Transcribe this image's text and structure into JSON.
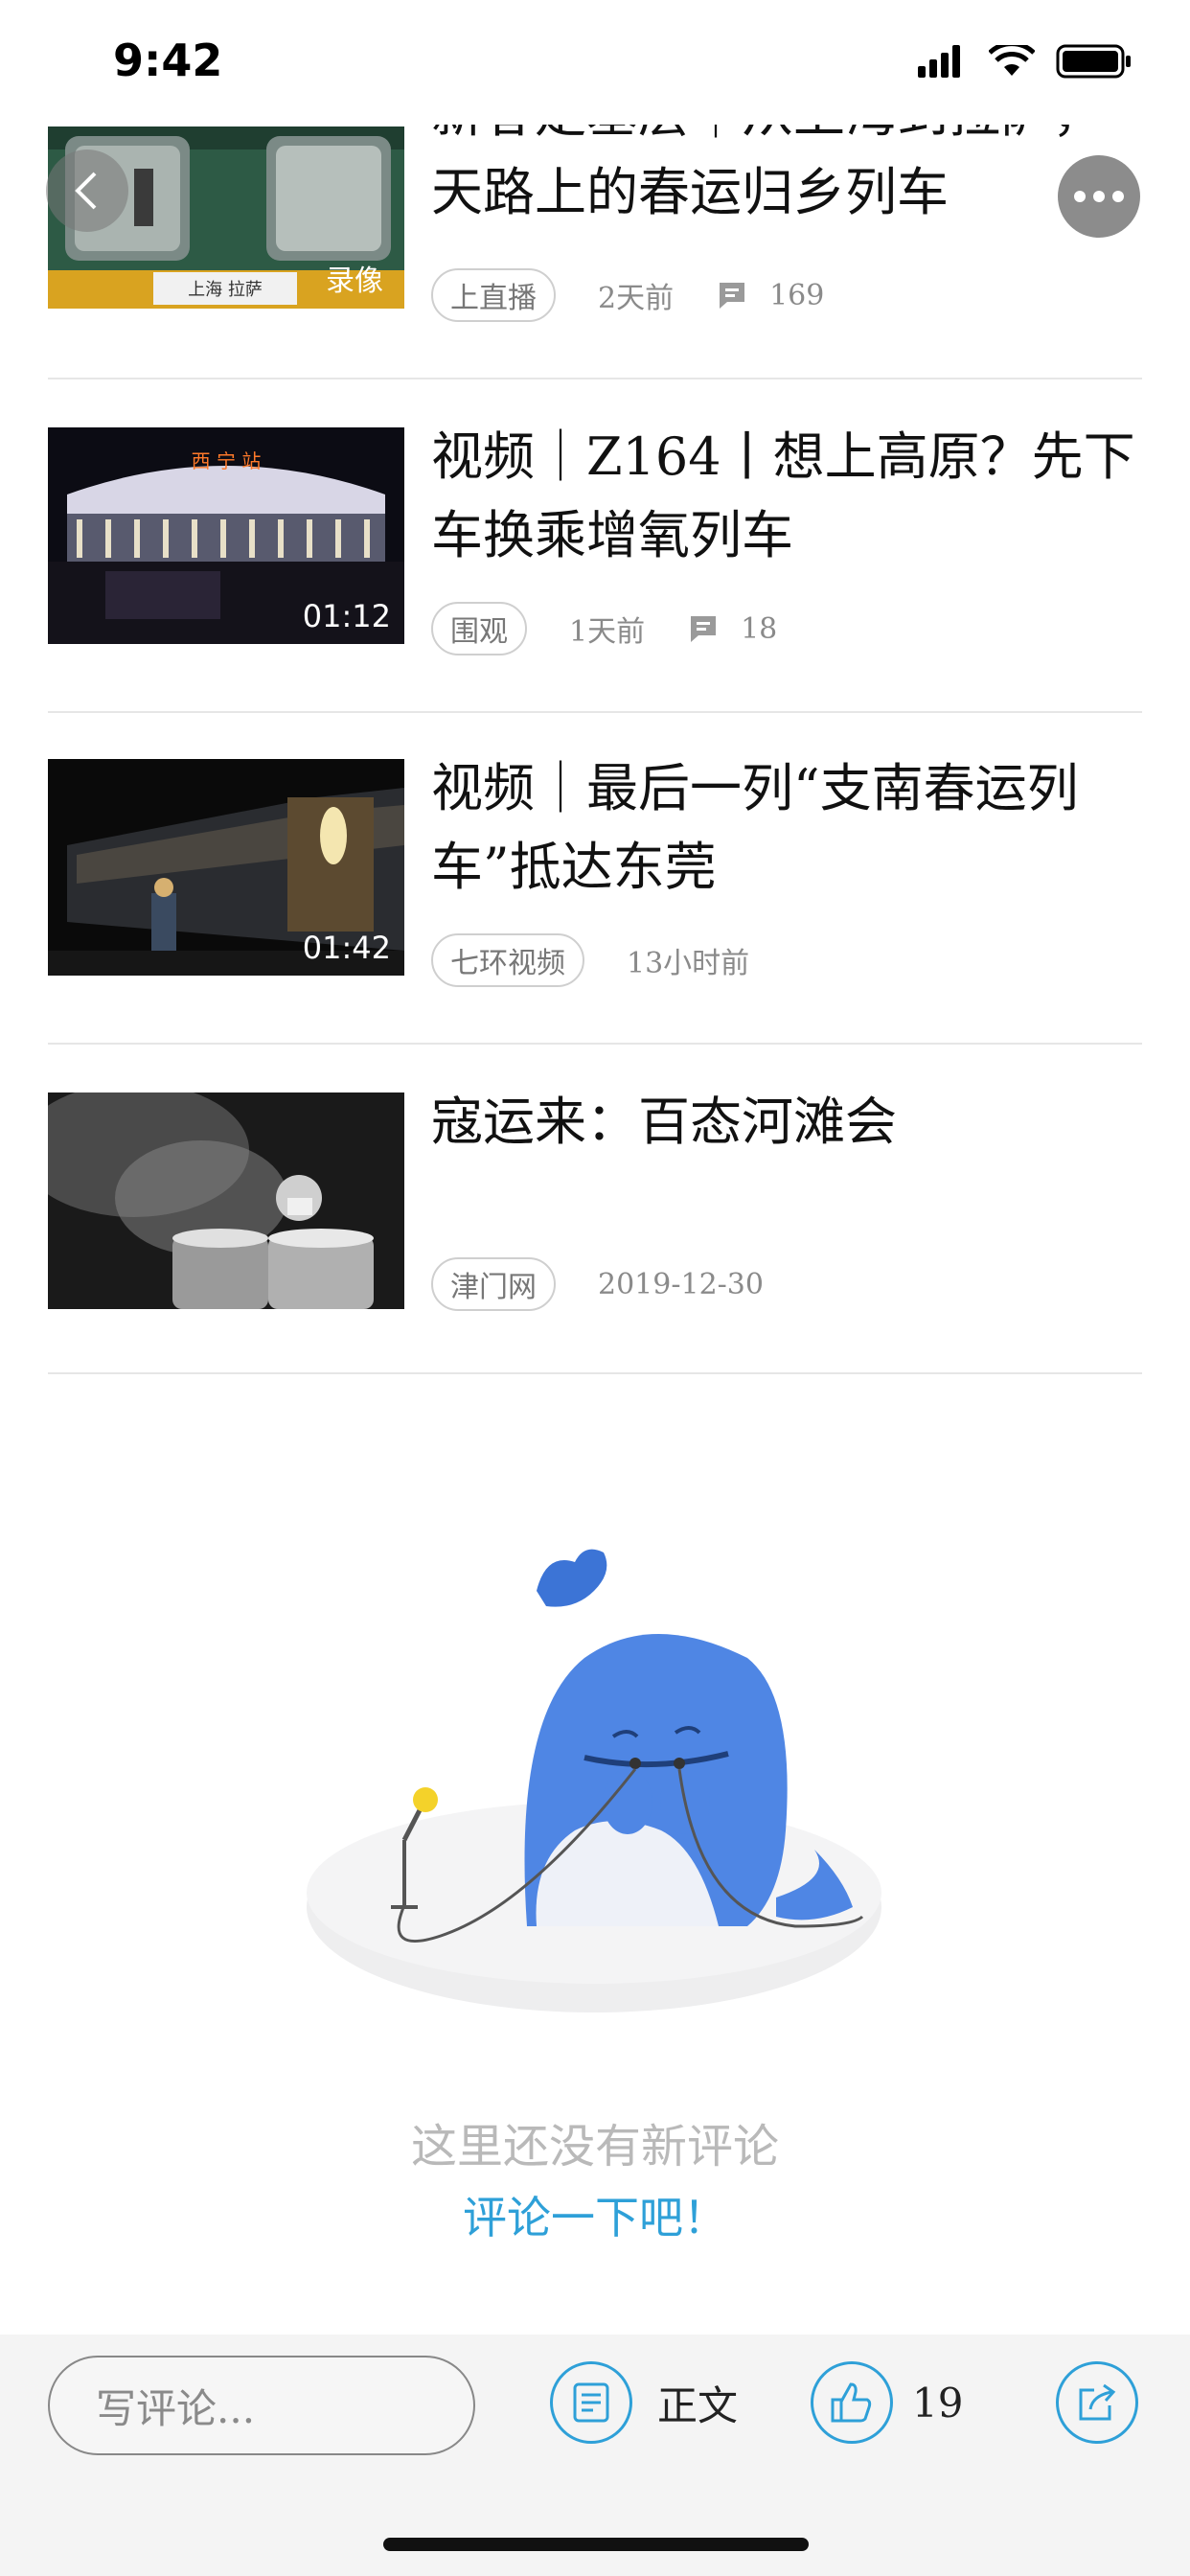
{
  "status_bar": {
    "time": "9:42"
  },
  "articles": [
    {
      "title": "新春走基层｜从上海到拉萨，天路上的春运归乡列车",
      "thumb_label": "录像",
      "thumb_sign": "上海 拉萨",
      "tag": "上直播",
      "time": "2天前",
      "comments": "169"
    },
    {
      "title": "视频｜Z164丨想上高原？先下车换乘增氧列车",
      "duration": "01:12",
      "thumb_sign": "西 宁 站",
      "tag": "围观",
      "time": "1天前",
      "comments": "18"
    },
    {
      "title": "视频｜最后一列“支南春运列车”抵达东莞",
      "duration": "01:42",
      "tag": "七环视频",
      "time": "13小时前"
    },
    {
      "title": "寇运来：百态河滩会",
      "tag": "津门网",
      "time": "2019-12-30"
    }
  ],
  "empty_state": {
    "line1": "这里还没有新评论",
    "line2": "评论一下吧！"
  },
  "toolbar": {
    "comment_placeholder": "写评论...",
    "article_label": "正文",
    "like_count": "19"
  },
  "colors": {
    "accent": "#2ea0d8",
    "muted": "#b9b9b9",
    "whale": "#4a82e0"
  },
  "icons": [
    "back-icon",
    "more-icon",
    "comment-icon",
    "article-icon",
    "like-icon",
    "share-icon"
  ]
}
